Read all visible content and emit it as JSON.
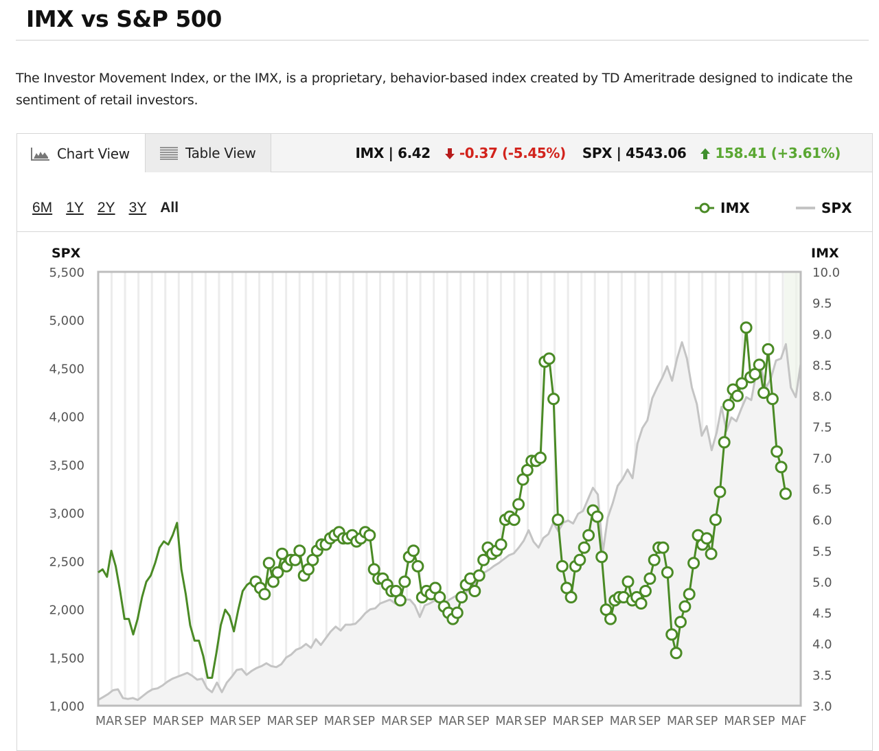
{
  "header": {
    "title": "IMX vs S&P 500",
    "description": "The Investor Movement Index, or the IMX, is a proprietary, behavior-based index created by TD Ameritrade designed to indicate the sentiment of retail investors."
  },
  "tabs": [
    {
      "label": "Chart View",
      "icon": "area-chart-icon",
      "active": true
    },
    {
      "label": "Table View",
      "icon": "table-lines-icon",
      "active": false
    }
  ],
  "quotes": {
    "imx_label": "IMX | 6.42",
    "imx_change": "-0.37 (-5.45%)",
    "imx_direction": "down",
    "spx_label": "SPX | 4543.06",
    "spx_change": "158.41 (+3.61%)",
    "spx_direction": "up",
    "down_color": "#d2231c",
    "up_color": "#5aa732"
  },
  "ranges": {
    "options": [
      "6M",
      "1Y",
      "2Y",
      "3Y",
      "All"
    ],
    "selected": "All"
  },
  "legend": {
    "imx": "IMX",
    "spx": "SPX"
  },
  "colors": {
    "imx": "#4a8a25",
    "spx": "#c4c4c4",
    "spx_fill": "#f3f3f3"
  },
  "chart_data": {
    "type": "line",
    "title": "IMX vs S&P 500",
    "left_axis": {
      "label": "SPX",
      "range": [
        1000,
        5500
      ],
      "ticks": [
        "5,500",
        "5,000",
        "4,500",
        "4,000",
        "3,500",
        "3,000",
        "2,500",
        "2,000",
        "1,500",
        "1,000"
      ]
    },
    "right_axis": {
      "label": "IMX",
      "range": [
        3.0,
        10.0
      ],
      "ticks": [
        "10.0",
        "9.5",
        "9.0",
        "8.5",
        "8.0",
        "7.5",
        "7.0",
        "6.5",
        "6.0",
        "5.5",
        "5.0",
        "4.5",
        "4.0",
        "3.5",
        "3.0"
      ]
    },
    "x_ticks": [
      "MAR",
      "SEP",
      "MAR",
      "SEP",
      "MAR",
      "SEP",
      "MAR",
      "SEP",
      "MAR",
      "SEP",
      "MAR",
      "SEP",
      "MAR",
      "SEP",
      "MAR",
      "SEP",
      "MAR",
      "SEP",
      "MAR",
      "SEP",
      "MAR",
      "SEP",
      "MAR",
      "SEP",
      "MAF"
    ],
    "grid": "vertical",
    "legend_position": "top-right",
    "series": [
      {
        "name": "IMX",
        "axis": "right",
        "markers_from_index": 36,
        "values": [
          5.15,
          5.2,
          5.08,
          5.5,
          5.25,
          4.85,
          4.4,
          4.4,
          4.15,
          4.4,
          4.75,
          5.0,
          5.1,
          5.3,
          5.55,
          5.65,
          5.6,
          5.75,
          5.95,
          5.2,
          4.8,
          4.3,
          4.05,
          4.05,
          3.8,
          3.45,
          3.45,
          3.85,
          4.3,
          4.55,
          4.45,
          4.2,
          4.55,
          4.85,
          4.95,
          5.0,
          5.0,
          4.9,
          4.8,
          5.3,
          5.0,
          5.15,
          5.45,
          5.25,
          5.35,
          5.35,
          5.5,
          5.1,
          5.2,
          5.35,
          5.5,
          5.6,
          5.6,
          5.7,
          5.75,
          5.8,
          5.7,
          5.7,
          5.75,
          5.65,
          5.7,
          5.8,
          5.75,
          5.2,
          5.05,
          5.05,
          4.95,
          4.85,
          4.85,
          4.7,
          5.0,
          5.4,
          5.5,
          5.25,
          4.75,
          4.85,
          4.8,
          4.9,
          4.75,
          4.6,
          4.5,
          4.4,
          4.5,
          4.75,
          4.95,
          5.05,
          4.85,
          5.1,
          5.35,
          5.55,
          5.45,
          5.5,
          5.6,
          6.0,
          6.05,
          6.0,
          6.25,
          6.65,
          6.8,
          6.95,
          6.95,
          7.0,
          8.55,
          8.6,
          7.95,
          6.0,
          5.25,
          4.9,
          4.75,
          5.25,
          5.35,
          5.55,
          5.75,
          6.15,
          6.05,
          5.4,
          4.55,
          4.4,
          4.7,
          4.75,
          4.75,
          5.0,
          4.7,
          4.75,
          4.65,
          4.85,
          5.05,
          5.35,
          5.55,
          5.55,
          5.15,
          4.15,
          3.85,
          4.35,
          4.6,
          4.8,
          5.3,
          5.75,
          5.6,
          5.7,
          5.45,
          6.0,
          6.45,
          7.25,
          7.85,
          8.1,
          8.0,
          8.2,
          9.1,
          8.3,
          8.35,
          8.5,
          8.05,
          8.75,
          7.95,
          7.1,
          6.85,
          6.42
        ]
      },
      {
        "name": "SPX",
        "axis": "left",
        "values": [
          1060,
          1090,
          1120,
          1160,
          1170,
          1080,
          1070,
          1080,
          1060,
          1100,
          1140,
          1170,
          1180,
          1210,
          1250,
          1280,
          1300,
          1320,
          1340,
          1310,
          1270,
          1280,
          1180,
          1140,
          1240,
          1140,
          1240,
          1300,
          1370,
          1380,
          1320,
          1360,
          1390,
          1410,
          1440,
          1410,
          1400,
          1430,
          1500,
          1530,
          1580,
          1600,
          1640,
          1600,
          1690,
          1630,
          1700,
          1770,
          1820,
          1780,
          1840,
          1840,
          1850,
          1900,
          1960,
          2000,
          2010,
          2060,
          2080,
          2100,
          2060,
          2080,
          2100,
          2100,
          2040,
          1920,
          2040,
          2060,
          2090,
          2100,
          2060,
          2100,
          2130,
          2160,
          2170,
          2200,
          2260,
          2350,
          2380,
          2410,
          2450,
          2480,
          2520,
          2560,
          2580,
          2640,
          2710,
          2820,
          2700,
          2640,
          2740,
          2780,
          2900,
          2810,
          2900,
          2920,
          2890,
          2990,
          3020,
          3140,
          3260,
          3190,
          2590,
          2950,
          3100,
          3280,
          3350,
          3450,
          3360,
          3720,
          3880,
          3960,
          4190,
          4300,
          4400,
          4520,
          4370,
          4600,
          4770,
          4600,
          4300,
          4130,
          3800,
          3900,
          3650,
          3830,
          4100,
          3850,
          3990,
          3950,
          4080,
          4200,
          4170,
          4450,
          4500,
          4300,
          4400,
          4580,
          4600,
          4750,
          4300,
          4200,
          4543
        ]
      }
    ]
  }
}
